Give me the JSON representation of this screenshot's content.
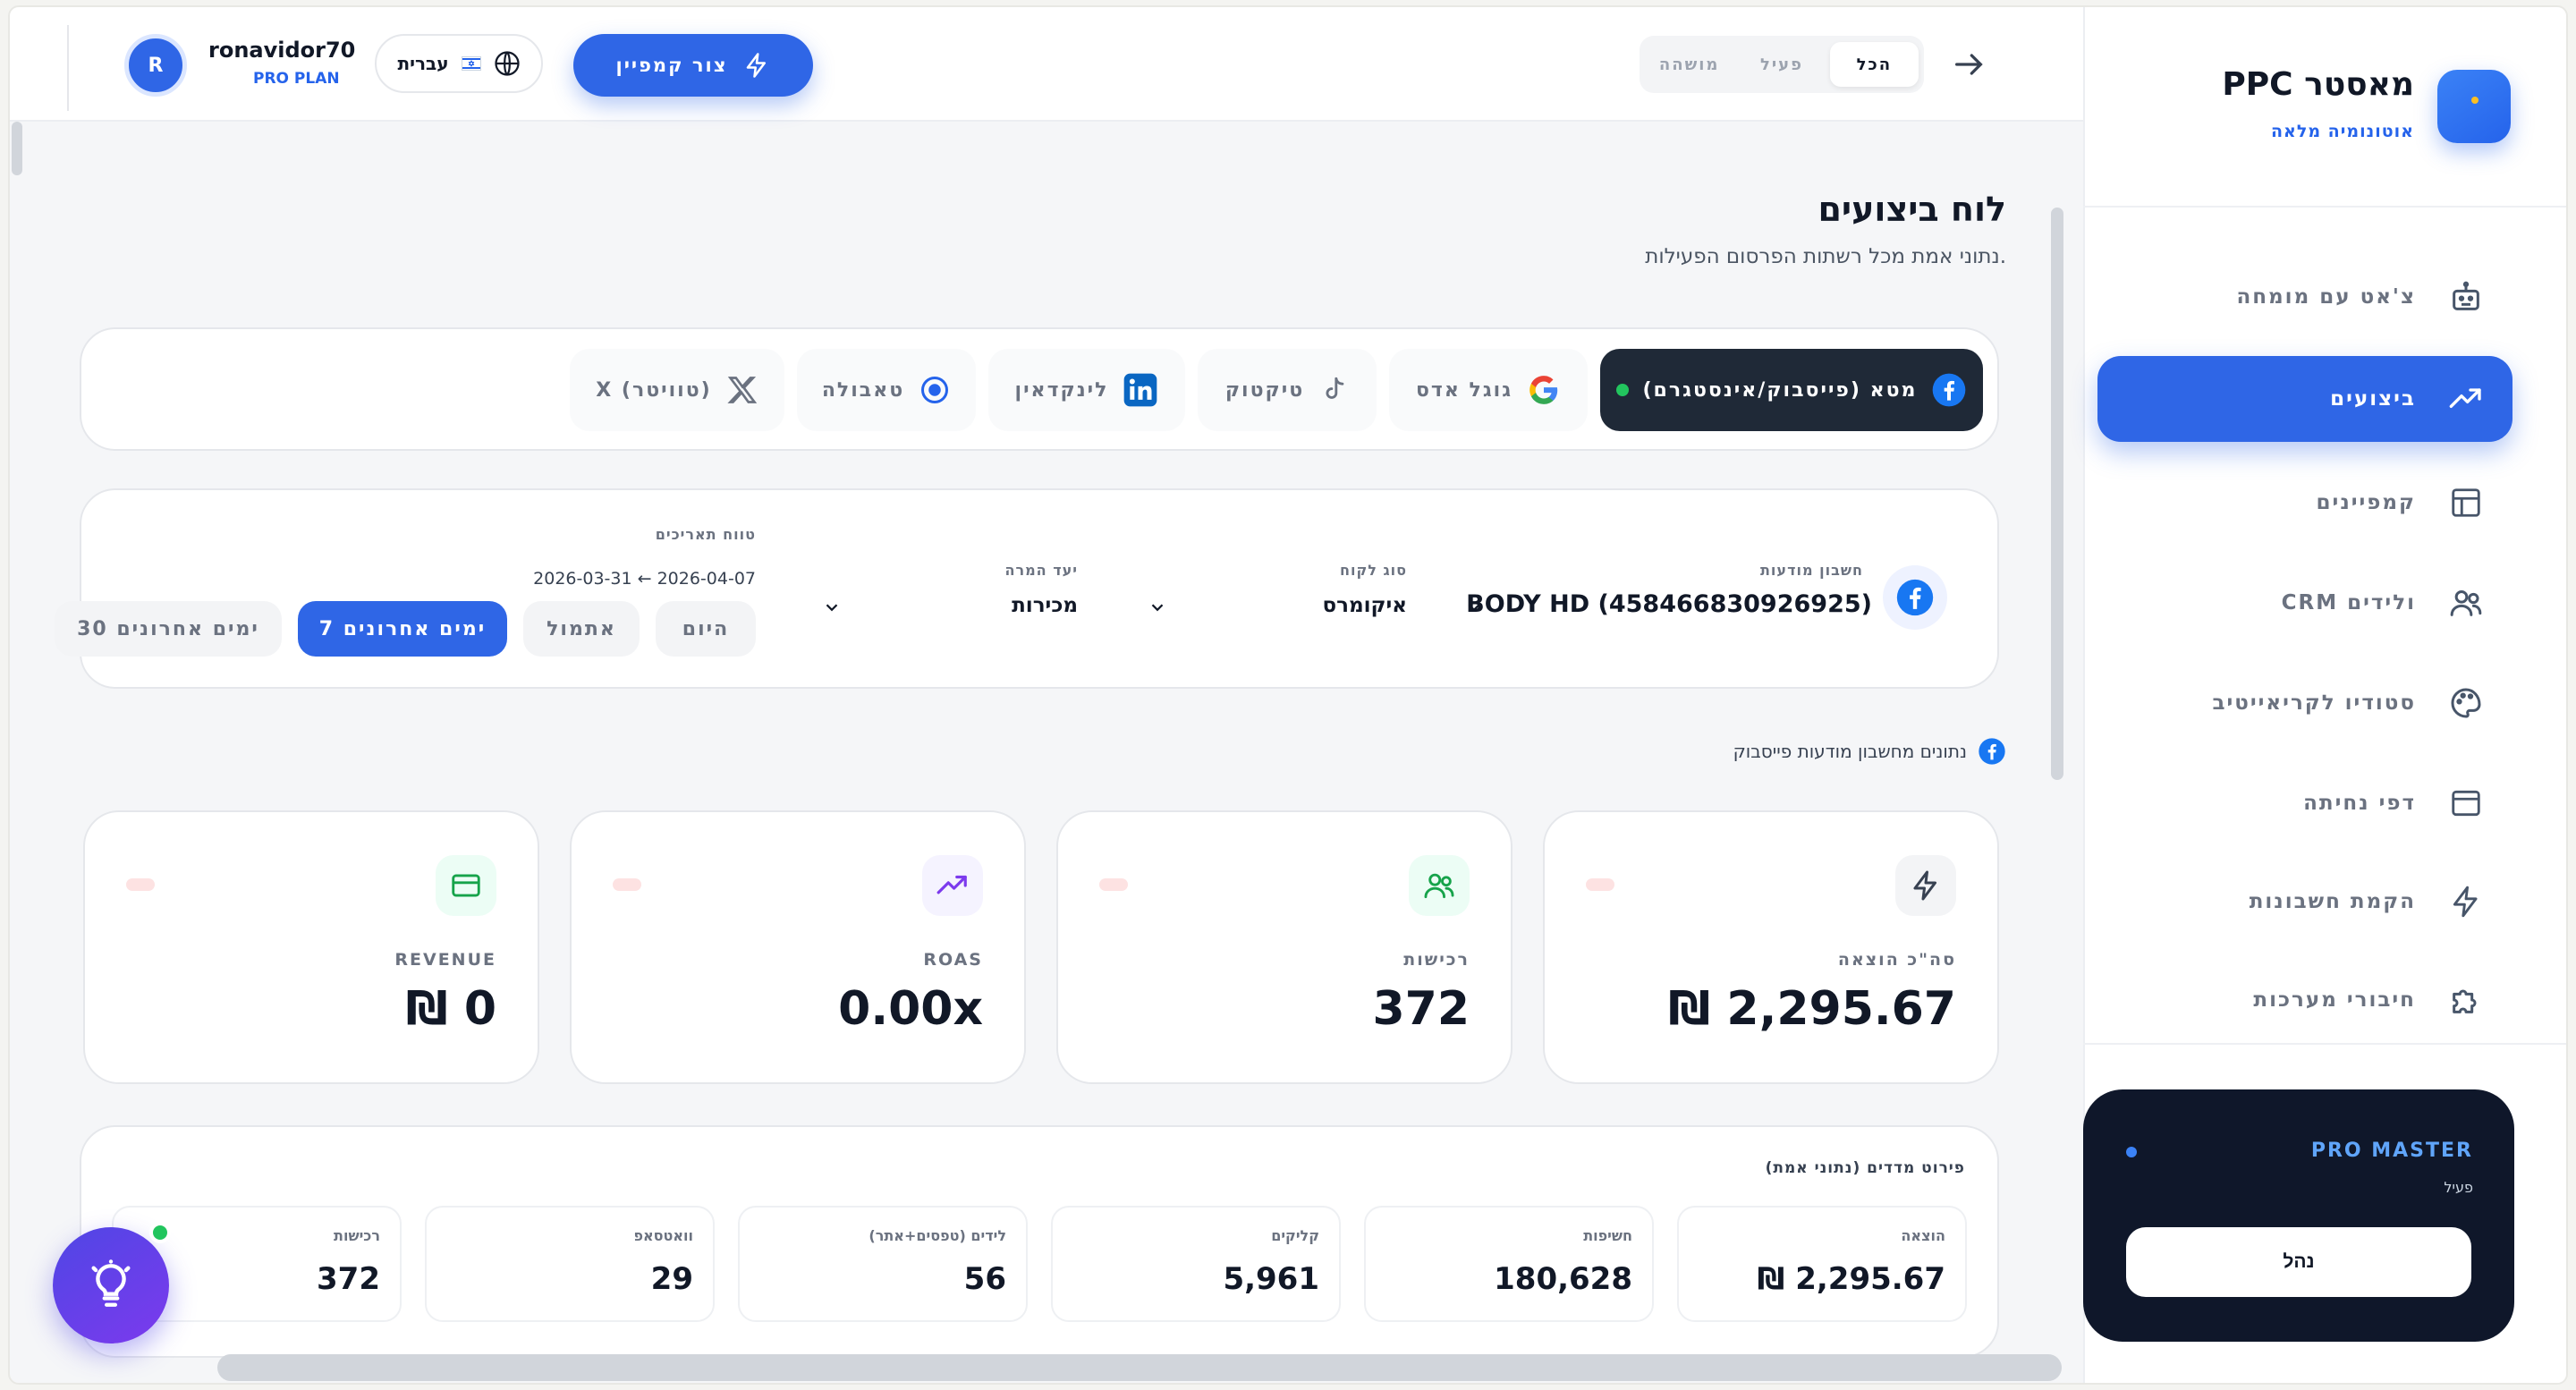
{
  "brand": {
    "title": "PPC מאסטר",
    "subtitle": "אוטונומיה מלאה"
  },
  "sidebar": {
    "items": [
      {
        "label": "צ'אט עם מומחה",
        "icon": "robot-icon"
      },
      {
        "label": "ביצועים",
        "icon": "trend-up-icon",
        "active": true
      },
      {
        "label": "קמפיינים",
        "icon": "layout-icon"
      },
      {
        "label": "CRM ולידים",
        "icon": "users-icon"
      },
      {
        "label": "סטודיו לקריאייטיב",
        "icon": "palette-icon"
      },
      {
        "label": "דפי נחיתה",
        "icon": "window-icon"
      },
      {
        "label": "הקמת חשבונות",
        "icon": "bolt-icon"
      },
      {
        "label": "חיבורי מערכות",
        "icon": "puzzle-icon"
      }
    ],
    "pro": {
      "title": "PRO MASTER",
      "status": "פעיל",
      "button": "נהל"
    }
  },
  "topbar": {
    "user_name": "ronavidor70",
    "user_plan": "PRO PLAN",
    "avatar_letter": "R",
    "language": "עברית",
    "create_campaign": "צור קמפיין",
    "filter_tabs": [
      "הכל",
      "פעיל",
      "מושהה"
    ]
  },
  "main": {
    "title": "לוח ביצועים",
    "subtitle": "נתוני אמת מכל רשתות הפרסום הפעילות.",
    "platforms": [
      {
        "label": "מטא (פייסבוק/אינסטגרם)",
        "icon": "facebook-icon",
        "active": true
      },
      {
        "label": "גוגל אדס",
        "icon": "google-icon"
      },
      {
        "label": "טיקטוק",
        "icon": "tiktok-icon"
      },
      {
        "label": "לינקדאין",
        "icon": "linkedin-icon"
      },
      {
        "label": "טאבולה",
        "icon": "taboola-icon"
      },
      {
        "label": "X (טוויטר)",
        "icon": "x-icon"
      }
    ],
    "filters": {
      "account_label": "חשבון מודעות",
      "account_value": "BODY HD (458466830926925)",
      "client_type_label": "סוג לקוח",
      "client_type_value": "איקומרס",
      "goal_label": "יעד המרה",
      "goal_value": "מכירות",
      "date_label": "טווח תאריכים",
      "date_value": "2026-03-31 ← 2026-04-07",
      "ranges": [
        "היום",
        "אתמול",
        "7 ימים אחרונים",
        "30 ימים אחרונים"
      ],
      "active_range": "7 ימים אחרונים"
    },
    "source_note": "נתונים מחשבון מודעות פייסבוק",
    "kpis": [
      {
        "label": "סה\"כ הוצאה",
        "value": "₪ 2,295.67",
        "icon": "bolt-icon"
      },
      {
        "label": "רכישות",
        "value": "372",
        "icon": "users-icon"
      },
      {
        "label": "ROAS",
        "value": "0.00x",
        "icon": "trend-up-icon"
      },
      {
        "label": "REVENUE",
        "value": "₪ 0",
        "icon": "card-icon"
      }
    ],
    "breakdown": {
      "title": "פירוט מדדים (נתוני אמת)",
      "metrics": [
        {
          "label": "הוצאה",
          "value": "₪ 2,295.67"
        },
        {
          "label": "חשיפות",
          "value": "180,628"
        },
        {
          "label": "קליקים",
          "value": "5,961"
        },
        {
          "label": "לידים (טפסים+אתר)",
          "value": "56"
        },
        {
          "label": "וואטסאפ",
          "value": "29"
        },
        {
          "label": "רכישות",
          "value": "372"
        }
      ]
    }
  },
  "colors": {
    "accent": "#2f66e6",
    "dark": "#0f172a",
    "success": "#22c55e"
  }
}
